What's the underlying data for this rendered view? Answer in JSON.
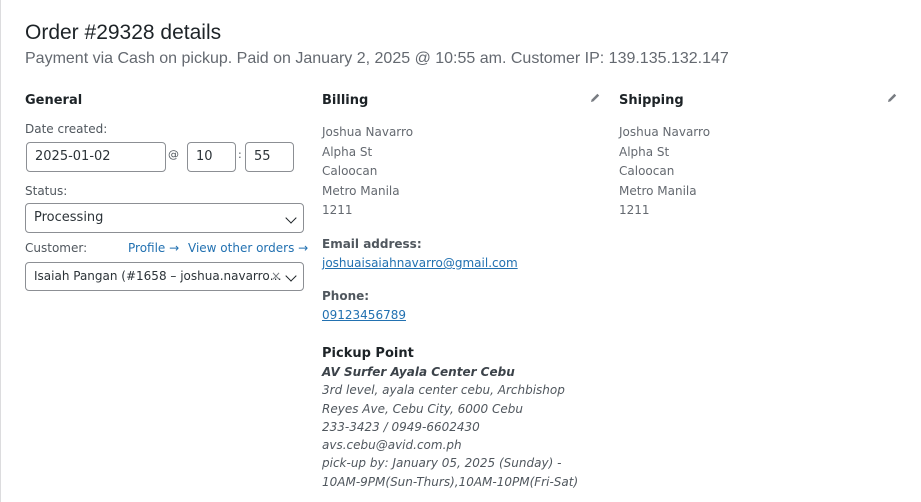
{
  "order": {
    "title": "Order #29328 details",
    "meta": "Payment via Cash on pickup. Paid on January 2, 2025 @ 10:55 am. Customer IP: 139.135.132.147"
  },
  "general": {
    "heading": "General",
    "date_label": "Date created:",
    "date_value": "2025-01-02",
    "at": "@",
    "hour": "10",
    "colon": ":",
    "minute": "55",
    "status_label": "Status:",
    "status_value": "Processing",
    "customer_label": "Customer:",
    "profile_link": "Profile →",
    "other_orders_link": "View other orders →",
    "customer_value": "Isaiah Pangan (#1658 – joshua.navarro…",
    "clear": "×"
  },
  "billing": {
    "heading": "Billing",
    "address": [
      "Joshua Navarro",
      "Alpha St",
      "Caloocan",
      "Metro Manila",
      "1211"
    ],
    "email_label": "Email address:",
    "email": "joshuaisaiahnavarro@gmail.com",
    "phone_label": "Phone:",
    "phone": "09123456789"
  },
  "pickup": {
    "title": "Pickup Point",
    "store": "AV Surfer Ayala Center Cebu",
    "address": "3rd level, ayala center cebu, Archbishop Reyes Ave, Cebu City, 6000 Cebu",
    "contact": "233-3423 / 0949-6602430",
    "email": "avs.cebu@avid.com.ph",
    "schedule": "pick-up by: January 05, 2025 (Sunday) - 10AM-9PM(Sun-Thurs),10AM-10PM(Fri-Sat)"
  },
  "shipping": {
    "heading": "Shipping",
    "address": [
      "Joshua Navarro",
      "Alpha St",
      "Caloocan",
      "Metro Manila",
      "1211"
    ]
  },
  "icons": {
    "edit": "pencil-icon",
    "chevron": "chevron-down-icon"
  }
}
